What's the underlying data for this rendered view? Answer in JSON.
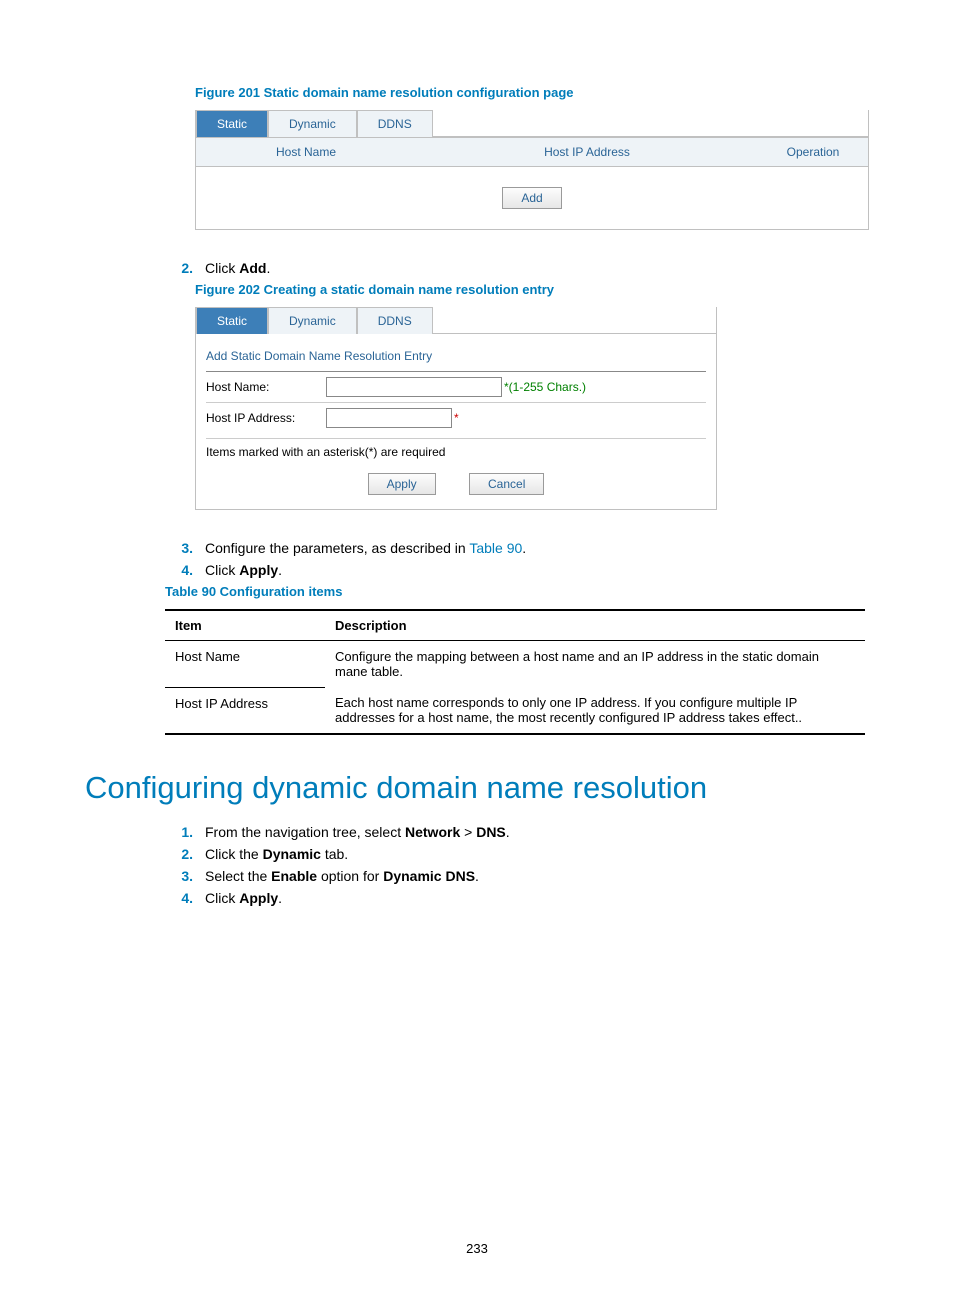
{
  "figure201": {
    "caption": "Figure 201 Static domain name resolution configuration page",
    "tabs": {
      "static": "Static",
      "dynamic": "Dynamic",
      "ddns": "DDNS"
    },
    "headers": {
      "hostname": "Host Name",
      "hostip": "Host IP Address",
      "operation": "Operation"
    },
    "add_btn": "Add"
  },
  "step2": {
    "num": "2.",
    "text_pre": "Click ",
    "bold": "Add",
    "text_post": "."
  },
  "figure202": {
    "caption": "Figure 202 Creating a static domain name resolution entry",
    "tabs": {
      "static": "Static",
      "dynamic": "Dynamic",
      "ddns": "DDNS"
    },
    "form_title": "Add Static Domain Name Resolution Entry",
    "rows": {
      "hostname_label": "Host Name:",
      "hostname_hint": "*(1-255 Chars.)",
      "hostip_label": "Host IP Address:",
      "hostip_hint": "*"
    },
    "note": "Items marked with an asterisk(*) are required",
    "apply_btn": "Apply",
    "cancel_btn": "Cancel"
  },
  "step3": {
    "num": "3.",
    "text": "Configure the parameters, as described in ",
    "link": "Table 90",
    "post": "."
  },
  "step4": {
    "num": "4.",
    "text_pre": "Click ",
    "bold": "Apply",
    "text_post": "."
  },
  "table90": {
    "caption": "Table 90 Configuration items",
    "headers": {
      "item": "Item",
      "desc": "Description"
    },
    "rows": [
      {
        "item": "Host Name",
        "desc": "Configure the mapping between a host name and an IP address in the static domain mane table."
      },
      {
        "item": "Host IP Address",
        "desc": "Each host name corresponds to only one IP address. If you configure multiple IP addresses for a host name, the most recently configured IP address takes effect.."
      }
    ]
  },
  "h1": "Configuring dynamic domain name resolution",
  "steps_dynamic": [
    {
      "num": "1.",
      "parts": [
        {
          "t": "From the navigation tree, select "
        },
        {
          "b": "Network"
        },
        {
          "t": " > "
        },
        {
          "b": "DNS"
        },
        {
          "t": "."
        }
      ]
    },
    {
      "num": "2.",
      "parts": [
        {
          "t": "Click the "
        },
        {
          "b": "Dynamic"
        },
        {
          "t": " tab."
        }
      ]
    },
    {
      "num": "3.",
      "parts": [
        {
          "t": "Select the "
        },
        {
          "b": "Enable"
        },
        {
          "t": " option for "
        },
        {
          "b": "Dynamic DNS"
        },
        {
          "t": "."
        }
      ]
    },
    {
      "num": "4.",
      "parts": [
        {
          "t": "Click "
        },
        {
          "b": "Apply"
        },
        {
          "t": "."
        }
      ]
    }
  ],
  "page_number": "233"
}
